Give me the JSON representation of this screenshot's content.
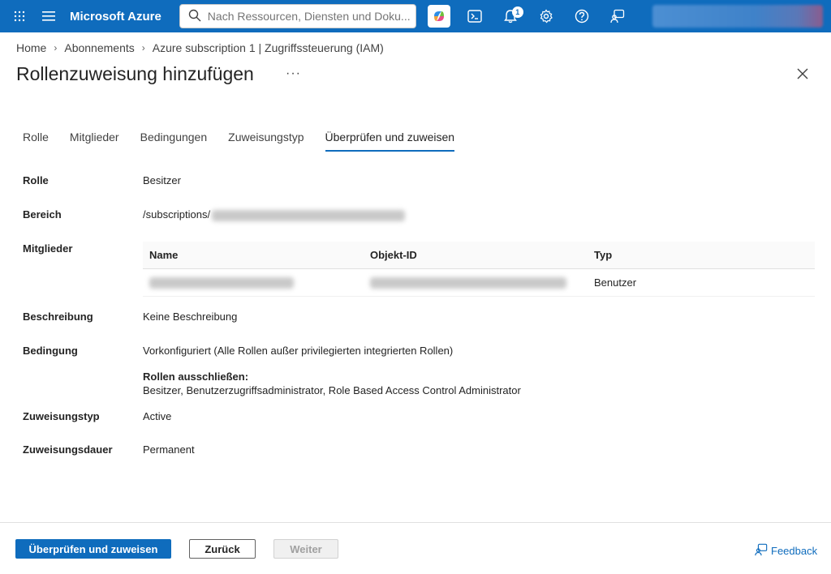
{
  "topbar": {
    "brand": "Microsoft Azure",
    "search_placeholder": "Nach Ressourcen, Diensten und Doku...",
    "notification_count": "1",
    "accent_color": "#0f6cbd"
  },
  "breadcrumb": [
    "Home",
    "Abonnements",
    "Azure subscription 1 | Zugriffssteuerung (IAM)"
  ],
  "page": {
    "title": "Rollenzuweisung hinzufügen",
    "more_label": "···"
  },
  "tabs": [
    {
      "label": "Rolle",
      "active": false
    },
    {
      "label": "Mitglieder",
      "active": false
    },
    {
      "label": "Bedingungen",
      "active": false
    },
    {
      "label": "Zuweisungstyp",
      "active": false
    },
    {
      "label": "Überprüfen und zuweisen",
      "active": true
    }
  ],
  "details": {
    "role_label": "Rolle",
    "role_value": "Besitzer",
    "scope_label": "Bereich",
    "scope_value": "/subscriptions/",
    "members_label": "Mitglieder",
    "members_table": {
      "headers": [
        "Name",
        "Objekt-ID",
        "Typ"
      ],
      "rows": [
        {
          "type": "Benutzer"
        }
      ]
    },
    "description_label": "Beschreibung",
    "description_value": "Keine Beschreibung",
    "condition_label": "Bedingung",
    "condition_value": "Vorkonfiguriert (Alle Rollen außer privilegierten integrierten Rollen)",
    "condition_exclude_title": "Rollen ausschließen:",
    "condition_exclude_value": "Besitzer, Benutzerzugriffsadministrator, Role Based Access Control Administrator",
    "assignment_type_label": "Zuweisungstyp",
    "assignment_type_value": "Active",
    "assignment_duration_label": "Zuweisungsdauer",
    "assignment_duration_value": "Permanent"
  },
  "footer": {
    "primary_label": "Überprüfen und zuweisen",
    "back_label": "Zurück",
    "next_label": "Weiter",
    "feedback_label": "Feedback"
  }
}
